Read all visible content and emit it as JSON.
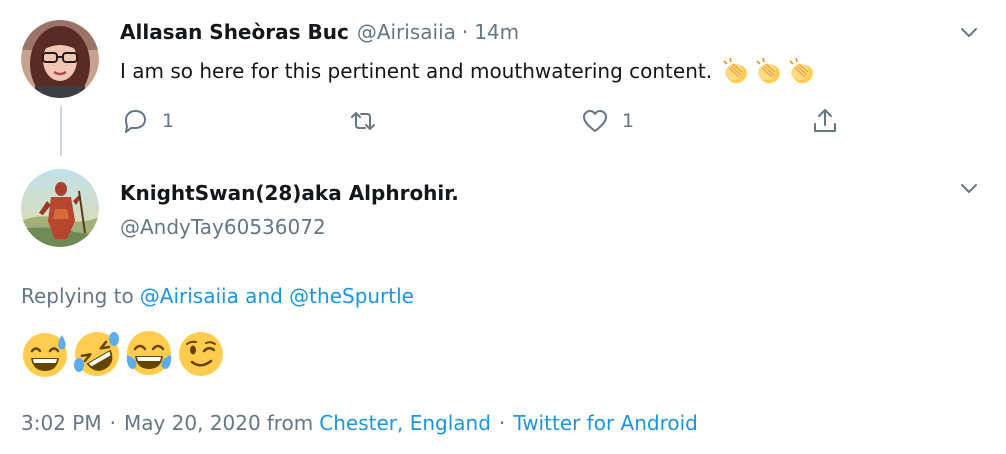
{
  "reply_tweet": {
    "display_name": "Allasan Sheòras Buc",
    "handle": "@Airisaiia",
    "separator": "·",
    "time": "14m",
    "text": "I am so here for this pertinent and mouthwatering content.",
    "emojis": [
      "clapping-hands-emoji",
      "clapping-hands-emoji",
      "clapping-hands-emoji"
    ],
    "actions": {
      "reply_count": "1",
      "retweet_count": "",
      "like_count": "1"
    }
  },
  "main_tweet": {
    "display_name": "KnightSwan(28)aka Alphrohir.",
    "handle": "@AndyTay60536072",
    "replying_prefix": "Replying to",
    "replying_to": "@Airisaiia and @theSpurtle",
    "emojis": [
      "grinning-sweat-emoji",
      "rofl-emoji",
      "tears-of-joy-emoji",
      "winking-face-emoji"
    ],
    "footer": {
      "time": "3:02 PM",
      "separator": "·",
      "date": "May 20, 2020",
      "from_label": "from",
      "location": "Chester, England",
      "source": "Twitter for Android"
    }
  },
  "colors": {
    "text_primary": "#14171a",
    "text_secondary": "#657786",
    "link": "#1b95e0",
    "divider": "#ccd6dd",
    "emoji_yellow": "#ffcc4d"
  }
}
